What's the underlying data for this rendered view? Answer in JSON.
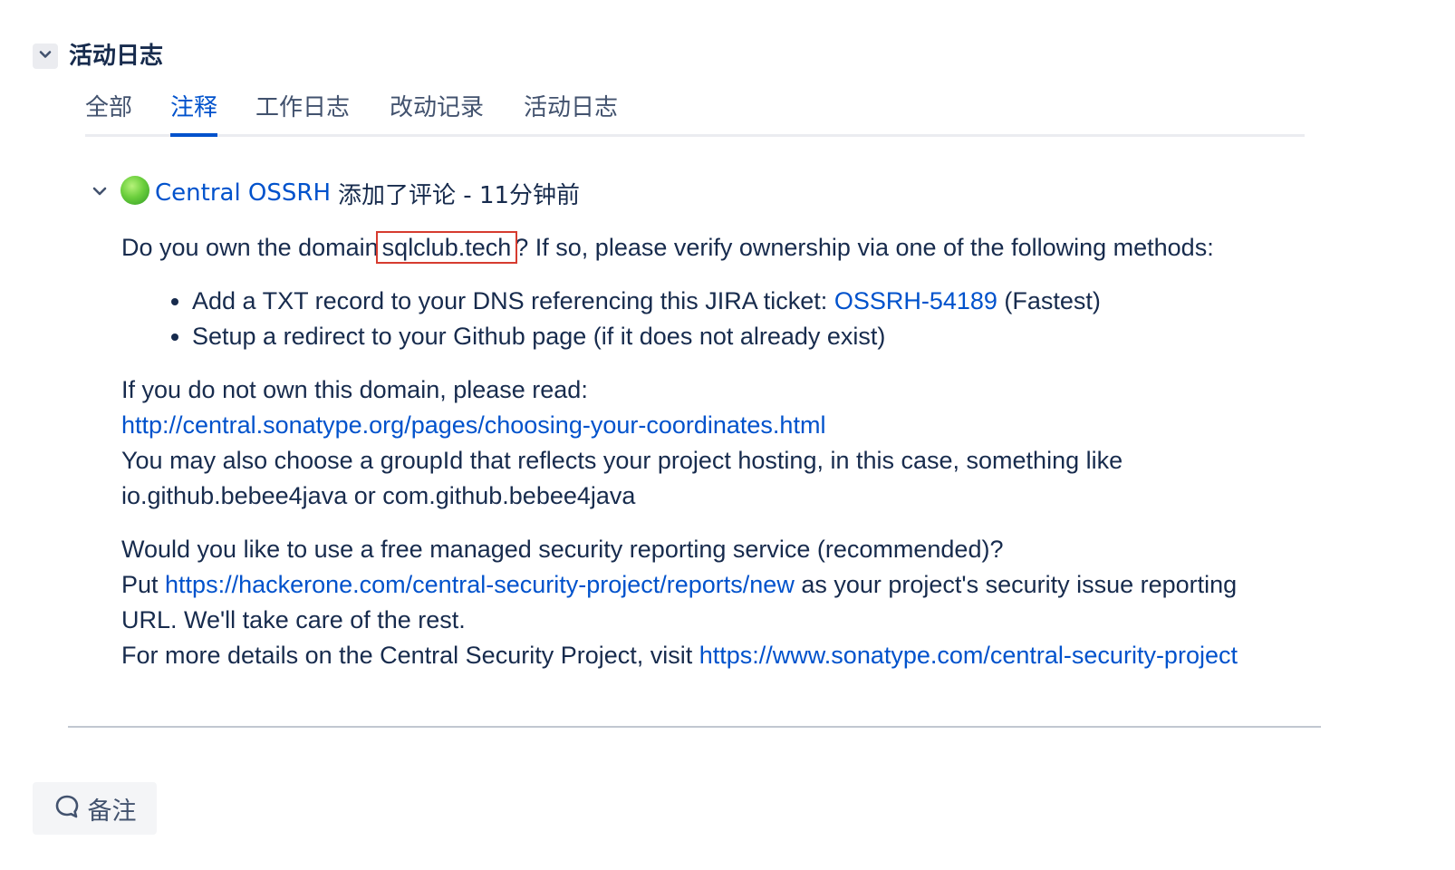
{
  "activity": {
    "title": "活动日志",
    "toggle_icon": "chevron-down-icon"
  },
  "tabs": [
    {
      "label": "全部",
      "active": false
    },
    {
      "label": "注释",
      "active": true
    },
    {
      "label": "工作日志",
      "active": false
    },
    {
      "label": "改动记录",
      "active": false
    },
    {
      "label": "活动日志",
      "active": false
    }
  ],
  "comment": {
    "author": "Central OSSRH",
    "action": "添加了评论 - 11分钟前",
    "body": {
      "line1_prefix": "Do you own the domain",
      "domain": "sqlclub.tech",
      "line1_suffix": "? If so, please verify ownership via one of the following methods:",
      "bullet1_prefix": "Add a TXT record to your DNS referencing this JIRA ticket: ",
      "bullet1_link": "OSSRH-54189",
      "bullet1_suffix": " (Fastest)",
      "bullet2": "Setup a redirect to your Github page (if it does not already exist)",
      "para2_line1": "If you do not own this domain, please read:",
      "para2_link": "http://central.sonatype.org/pages/choosing-your-coordinates.html",
      "para2_line3": "You may also choose a groupId that reflects your project hosting, in this case, something like io.github.bebee4java or com.github.bebee4java",
      "para3_line1": "Would you like to use a free managed security reporting service (recommended)?",
      "para3_put": "Put ",
      "para3_link1": "https://hackerone.com/central-security-project/reports/new",
      "para3_after_link1": " as your project's security issue reporting URL. We'll take care of the rest.",
      "para3_more": "For more details on the Central Security Project, visit ",
      "para3_link2": "https://www.sonatype.com/central-security-project"
    }
  },
  "note_button": {
    "label": "备注",
    "icon": "comment-icon"
  },
  "colors": {
    "link": "#0052cc",
    "text": "#172b4d",
    "highlight_box": "#d63b2f",
    "tab_underline": "#ebecf0"
  }
}
